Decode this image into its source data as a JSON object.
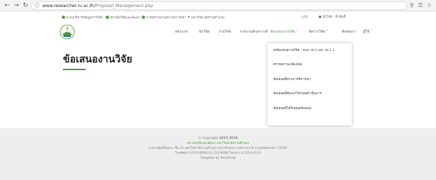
{
  "browser": {
    "url_host": "www.researcher.ru.ac.th",
    "url_path": "/Proposal_Management.php",
    "back_icon": "arrow-left",
    "forward_icon": "arrow-right",
    "reload_icon": "reload",
    "info_icon": "info",
    "search_icon": "magnifier",
    "key_icon": "key",
    "star_icon": "star"
  },
  "topstrip": {
    "links": [
      "ระบบบริหารข้อมูลการวิจัย",
      "สถาบันวิจัยและพัฒนา",
      "การส่งรายงานความก้าวหน้า",
      "มหาวิทยาลัยรามคำแหง"
    ],
    "cart": "(0)",
    "user": "นักวิจัย - ทิวสิทธิ์"
  },
  "nav": {
    "items": [
      "หน้าแรก",
      "นักวิจัย",
      "งานวิจัย",
      "รายงานสังเคราะห์",
      "ข้อเสนองานวิจัย",
      "จัดการวิจัย",
      "ติดต่อเรา",
      "ผู้ใช้"
    ],
    "active_index": 4
  },
  "page": {
    "title": "ข้อเสนองานวิจัย"
  },
  "dropdown": {
    "items": [
      "ส่งข้อเสนองานวิจัย - แบบ วจ.1 และ วจ.1.1",
      "ตรวจสถานะข้อเสนอ",
      "ข้อเสนอที่ผ่านการพิจารณา",
      "ข้อเสนอที่ต้องแก้ไขก่อนดำเนินการ",
      "ข้อเสนอที่ได้รับทุนสนับสนุน"
    ]
  },
  "footer": {
    "copyright_prefix": "© Copyright",
    "copyright_years": "2015-2018",
    "org": "สถาบันวิจัยและพัฒนา มหาวิทยาลัยรามคำแหง",
    "address": "อาคารศูนย์สัมมนา ชั้น 12 มหาวิทยาลัยรามคำแหง แขวงหัวหมาก เขตบางกะปิ กรุงเทพมหานคร 10240",
    "contact": "โทรศัพท์ 0-2310-8000,02-310-8684 โทรสาร 0-2310-8118",
    "template": "Template by Bootstrap"
  },
  "colors": {
    "accent": "#4a9b3a",
    "footer_bg": "#eeeeee"
  }
}
